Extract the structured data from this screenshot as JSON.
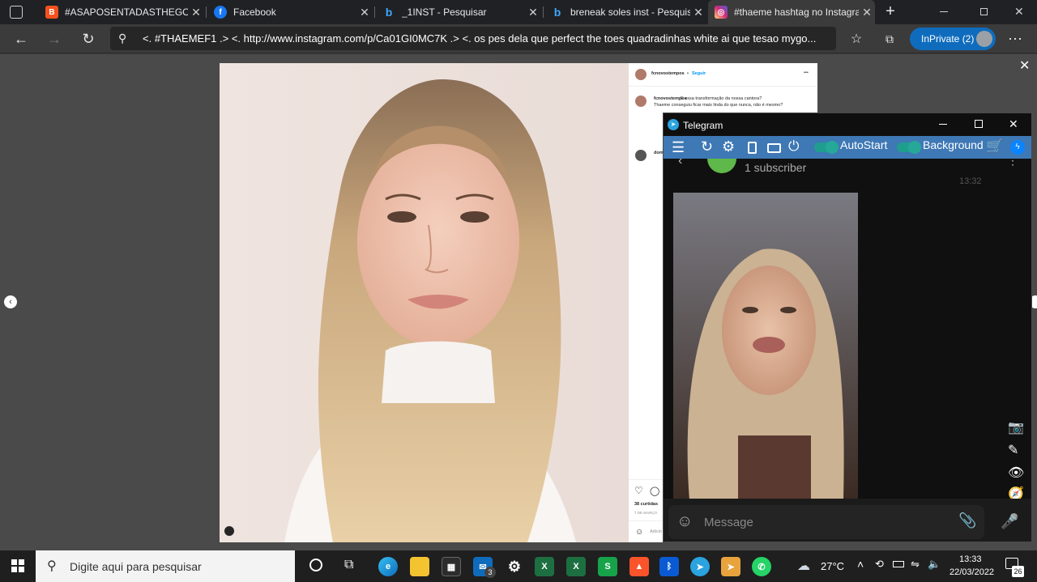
{
  "browser": {
    "tabs": [
      {
        "title": "#ASAPOSENTADASTHEGOOD",
        "favicon": "blogger-icon",
        "color": "#f4511e"
      },
      {
        "title": "Facebook",
        "favicon": "facebook-icon",
        "color": "#1877f2"
      },
      {
        "title": "_1INST - Pesquisar",
        "favicon": "bing-icon",
        "color": "#0f6cbd"
      },
      {
        "title": "breneak soles inst - Pesquisar",
        "favicon": "bing-icon",
        "color": "#0f6cbd"
      },
      {
        "title": "#thaeme hashtag no Instagra",
        "favicon": "instagram-icon",
        "color": "#d6249f"
      }
    ],
    "new_tab_icon": "+",
    "address": "<. #THAEMEF1 .> <. http://www.instagram.com/p/Ca01GI0MC7K .> <. os pes dela que perfect the toes quadradinhas white ai que tesao mygo...",
    "inprivate_label": "InPrivate (2)"
  },
  "instagram": {
    "username": "fcnovostempos",
    "follow": "Seguir",
    "more": "•••",
    "caption_user": "fcnovostempos",
    "caption_line1": "E essa transformação da nossa cantora?",
    "caption_line2": "Thaeme conseguiu ficar mais linda do que nunca, não é mesmo?",
    "likes": "38 curtidas",
    "date": "7 DE MARÇO",
    "comment_user": "dom",
    "add_comment": "Adicio"
  },
  "telegram": {
    "title": "Telegram",
    "toolbar_autostart": "AutoStart",
    "toolbar_background": "Background",
    "channel_subscribers": "1 subscriber",
    "message_time": "13:32",
    "message_placeholder": "Message"
  },
  "taskbar": {
    "search_placeholder": "Digite aqui para pesquisar",
    "weather": "27°C",
    "time": "13:33",
    "date": "22/03/2022",
    "mail_badge": "3",
    "notification_count": "26"
  }
}
